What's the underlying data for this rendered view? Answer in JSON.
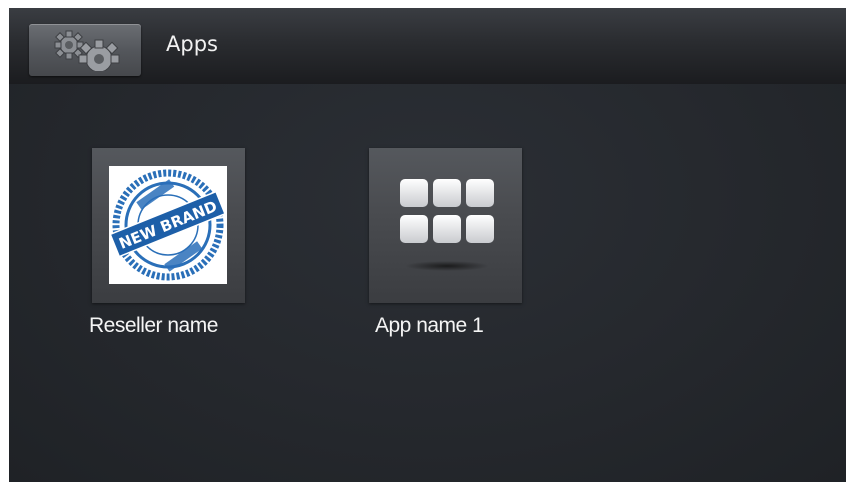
{
  "header": {
    "title": "Apps",
    "settings_icon": "gears-icon"
  },
  "apps": [
    {
      "label": "Reseller name",
      "icon": "new-brand-logo",
      "logo_text": "NEW BRAND"
    },
    {
      "label": "App name 1",
      "icon": "app-grid-icon"
    }
  ],
  "colors": {
    "background": "#25282d",
    "titlebar": "#2a2c30",
    "logo_blue": "#2a6fb8",
    "tile_grey": "#4a4c50"
  }
}
